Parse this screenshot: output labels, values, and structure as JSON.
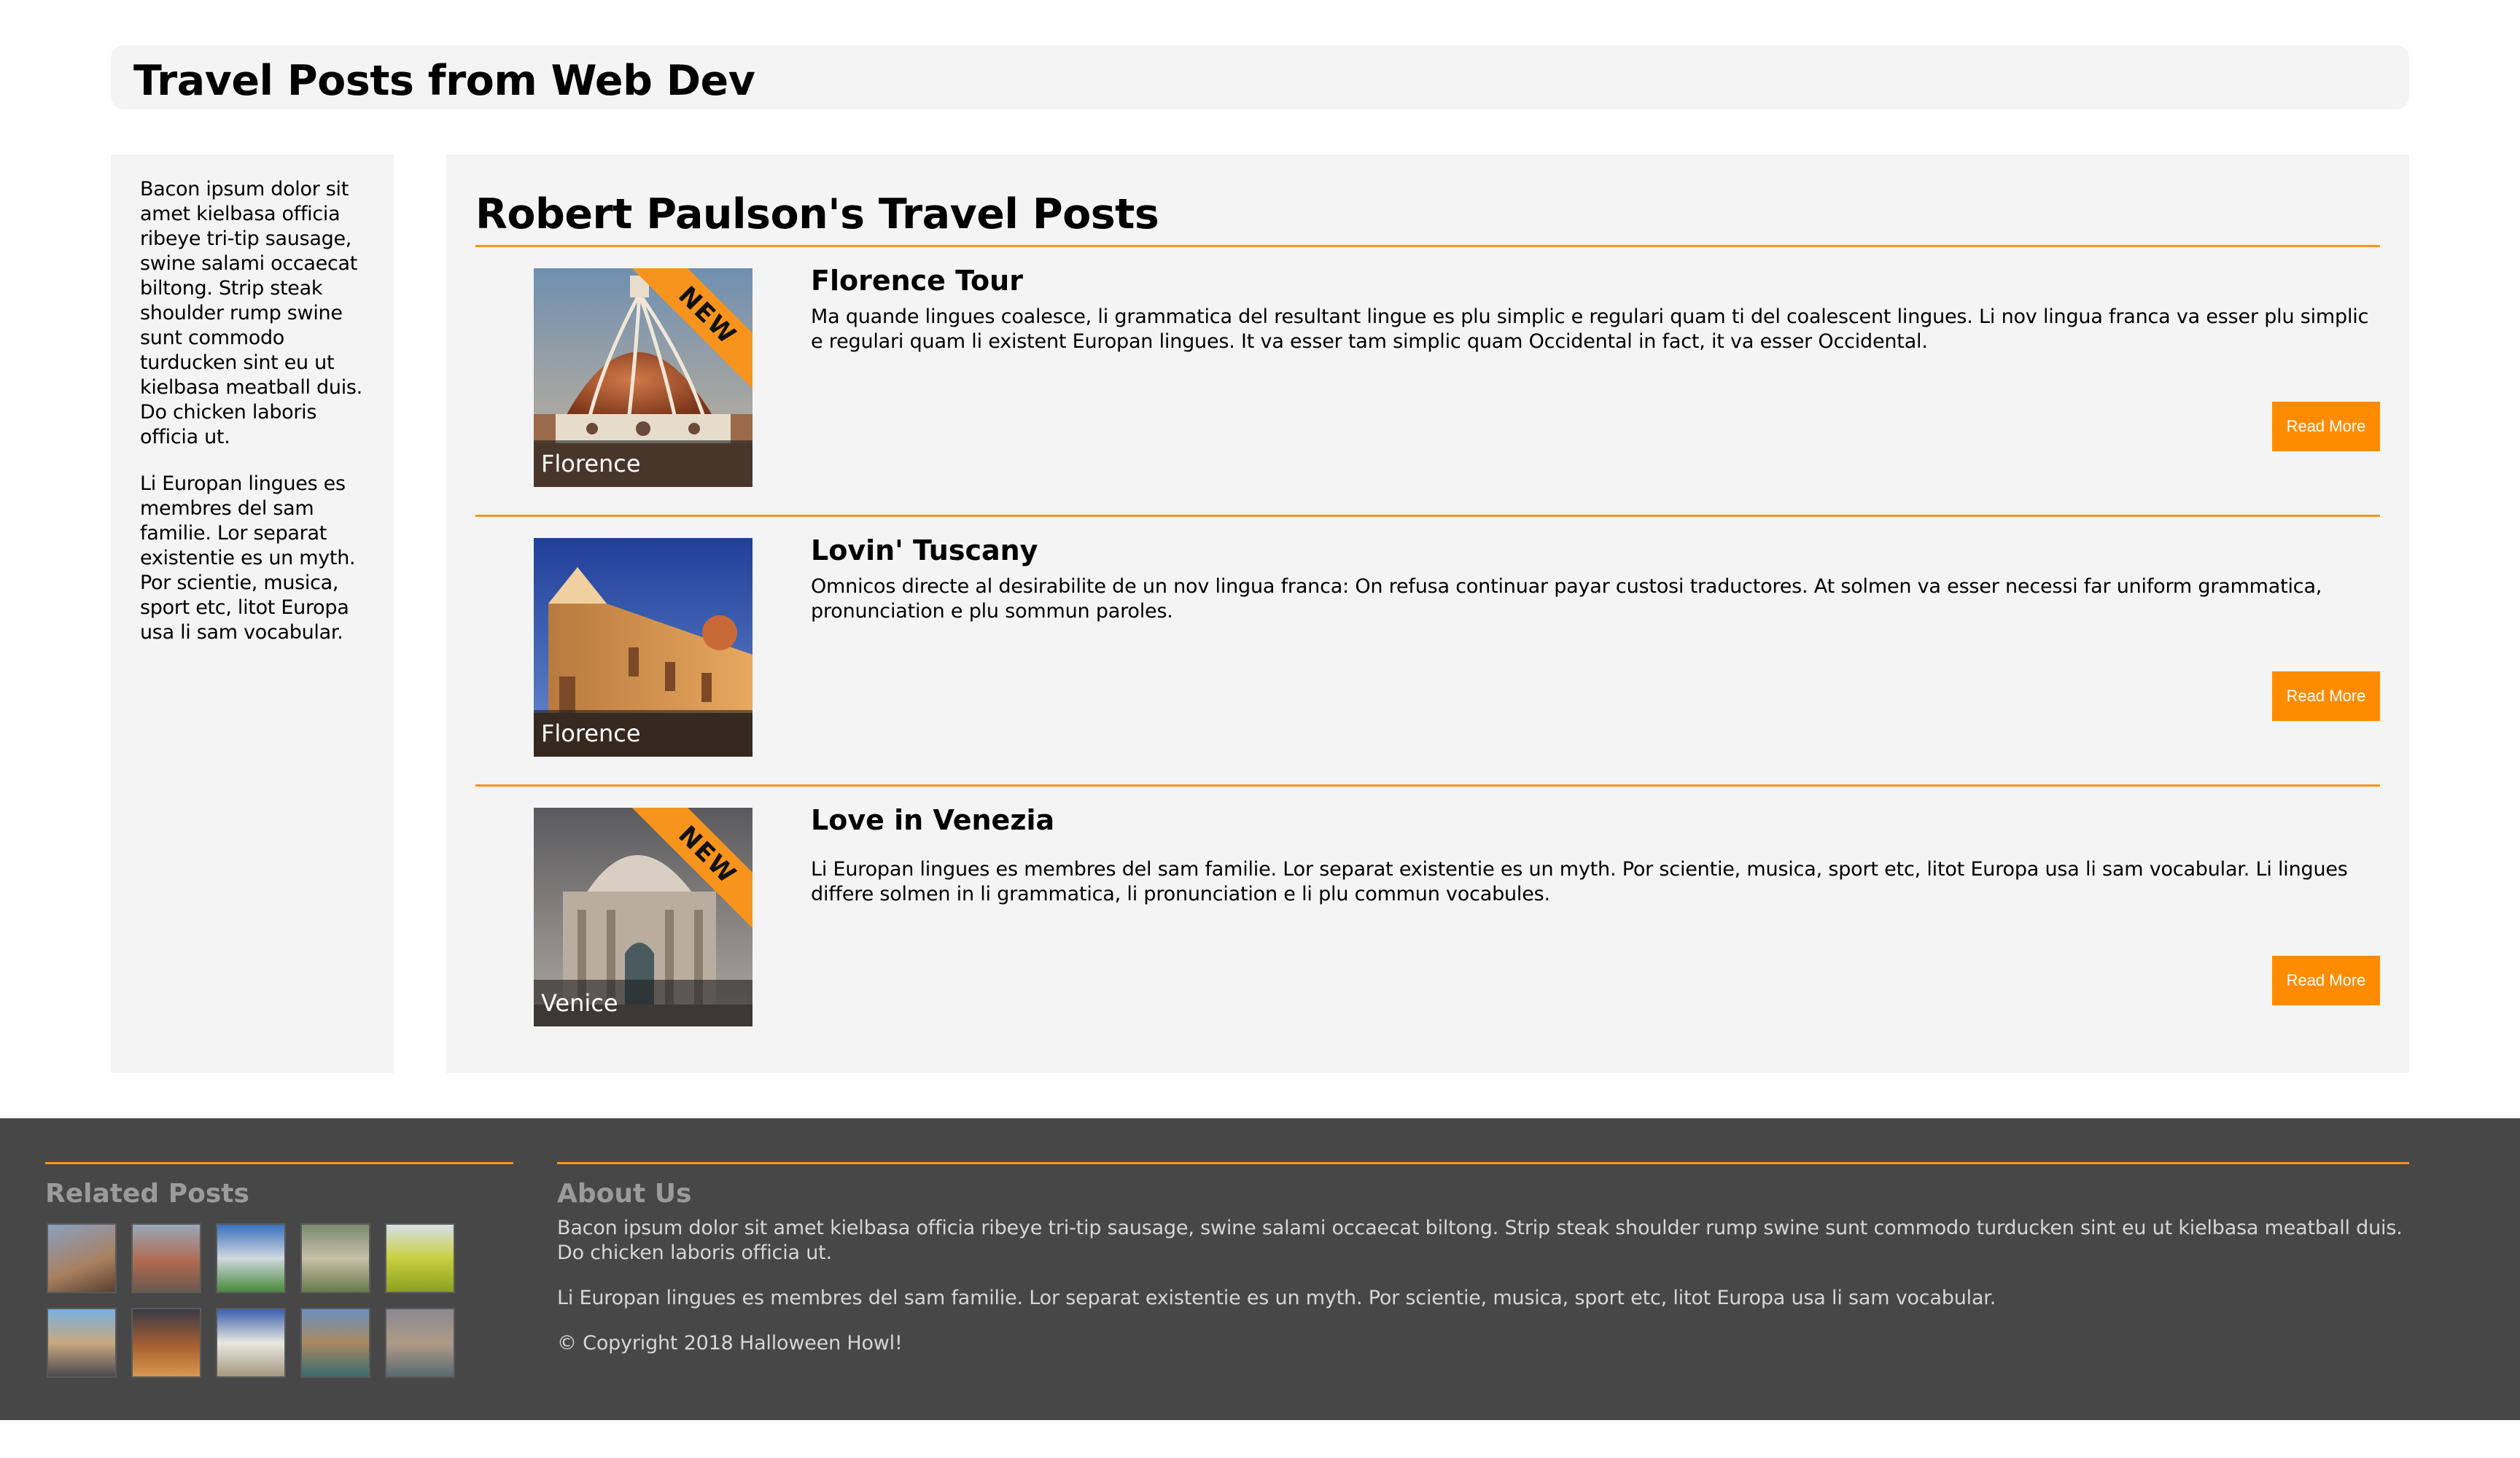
{
  "header": {
    "title": "Travel Posts from Web Dev"
  },
  "sidebar": {
    "paragraphs": [
      "Bacon ipsum dolor sit amet kielbasa officia ribeye tri-tip sausage, swine salami occaecat biltong. Strip steak shoulder rump swine sunt commodo turducken sint eu ut kielbasa meatball duis. Do chicken laboris officia ut.",
      "Li Europan lingues es membres del sam familie. Lor separat existentie es un myth. Por scientie, musica, sport etc, litot Europa usa li sam vocabular."
    ]
  },
  "main": {
    "title": "Robert Paulson's Travel Posts",
    "posts": [
      {
        "title": "Florence Tour",
        "caption": "Florence",
        "badge": "NEW",
        "body": "Ma quande lingues coalesce, li grammatica del resultant lingue es plu simplic e regulari quam ti del coalescent lingues. Li nov lingua franca va esser plu simplic e regulari quam li existent Europan lingues. It va esser tam simplic quam Occidental in fact, it va esser Occidental.",
        "button": "Read More"
      },
      {
        "title": "Lovin' Tuscany",
        "caption": "Florence",
        "badge": "",
        "body": "Omnicos directe al desirabilite de un nov lingua franca: On refusa continuar payar custosi traductores. At solmen va esser necessi far uniform grammatica, pronunciation e plu sommun paroles.",
        "button": "Read More"
      },
      {
        "title": "Love in Venezia",
        "caption": "Venice",
        "badge": "NEW",
        "body": "Li Europan lingues es membres del sam familie. Lor separat existentie es un myth. Por scientie, musica, sport etc, litot Europa usa li sam vocabular. Li lingues differe solmen in li grammatica, li pronunciation e li plu commun vocabules.",
        "button": "Read More"
      }
    ]
  },
  "footer": {
    "related_title": "Related Posts",
    "about_title": "About Us",
    "about_paragraphs": [
      "Bacon ipsum dolor sit amet kielbasa officia ribeye tri-tip sausage, swine salami occaecat biltong. Strip steak shoulder rump swine sunt commodo turducken sint eu ut kielbasa meatball duis. Do chicken laboris officia ut.",
      "Li Europan lingues es membres del sam familie. Lor separat existentie es un myth. Por scientie, musica, sport etc, litot Europa usa li sam vocabular."
    ],
    "copyright": "© Copyright 2018 Halloween Howl!"
  },
  "colors": {
    "accent": "#f7941d",
    "button": "#ff8c00",
    "panel": "#f4f4f4",
    "footer": "#474747"
  }
}
